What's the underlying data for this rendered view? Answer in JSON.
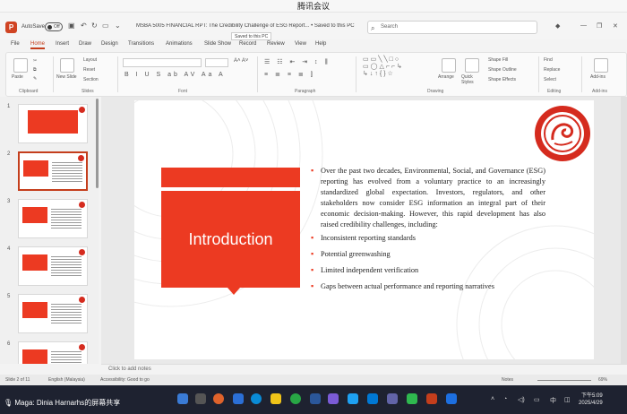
{
  "meeting": {
    "title": "腾讯会议"
  },
  "titlebar": {
    "autosave_label": "AutoSave",
    "autosave_state": "Off",
    "file_title": "MSBA 5005 FINANCIAL RPT: The Credibility Challenge of ESG Report... • Saved to this PC",
    "saved_tooltip": "Saved to this PC",
    "search_placeholder": "Search"
  },
  "tabs": [
    "File",
    "Home",
    "Insert",
    "Draw",
    "Design",
    "Transitions",
    "Animations",
    "Slide Show",
    "Record",
    "Review",
    "View",
    "Help"
  ],
  "ribbon": {
    "groups": [
      "Clipboard",
      "Slides",
      "Font",
      "Paragraph",
      "Drawing",
      "Editing",
      "Add-ins"
    ],
    "paste_label": "Paste",
    "new_slide_label": "New Slide",
    "layout_label": "Layout",
    "reset_label": "Reset",
    "section_label": "Section",
    "arrange_label": "Arrange",
    "quick_styles_label": "Quick Styles",
    "shape_fill_label": "Shape Fill",
    "shape_outline_label": "Shape Outline",
    "shape_effects_label": "Shape Effects",
    "find_label": "Find",
    "replace_label": "Replace",
    "select_label": "Select",
    "addins_label": "Add-ins"
  },
  "slide_panel": {
    "numbers": [
      "1",
      "2",
      "3",
      "4",
      "5",
      "6"
    ]
  },
  "slide": {
    "title": "Introduction",
    "bullets": [
      "Over the past two decades, Environmental, Social, and Governance (ESG) reporting has evolved from a voluntary practice to an increasingly standardized global expectation. Investors, regulators, and other stakeholders now consider ESG information an integral part of their economic decision-making. However, this rapid development has also raised credibility challenges, including:",
      "Inconsistent reporting standards",
      "Potential greenwashing",
      "Limited independent verification",
      "Gaps between actual performance and reporting narratives"
    ]
  },
  "notes": {
    "placeholder": "Click to add notes"
  },
  "statusbar": {
    "slide_info": "Slide 2 of 11",
    "language": "English (Malaysia)",
    "accessibility": "Accessibility: Good to go",
    "notes_btn": "Notes",
    "zoom": "69%"
  },
  "taskbar": {
    "speaker": "Maga: Dinia Harnarhs的屏幕共享",
    "time": "下午5:09",
    "date": "2025/4/29"
  },
  "colors": {
    "accent": "#ec3a22",
    "ppt": "#c43e1c",
    "taskbar": "#1e2230"
  }
}
